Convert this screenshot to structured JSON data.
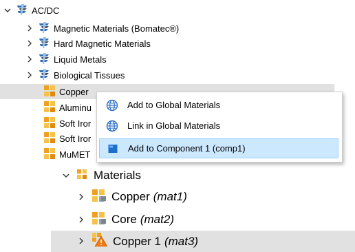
{
  "library_tree": {
    "root": {
      "label": "AC/DC",
      "icon": "acdc-library-icon",
      "expanded": true
    },
    "folders": [
      {
        "label": "Magnetic Materials (Bomatec®)",
        "icon": "acdc-library-icon"
      },
      {
        "label": "Hard Magnetic Materials",
        "icon": "acdc-library-icon"
      },
      {
        "label": "Liquid Metals",
        "icon": "acdc-library-icon"
      },
      {
        "label": "Biological Tissues",
        "icon": "acdc-library-icon"
      }
    ],
    "materials": [
      {
        "label": "Copper",
        "icon": "material-icon",
        "selected": true
      },
      {
        "label": "Aluminu",
        "icon": "material-icon"
      },
      {
        "label": "Soft Iror",
        "icon": "material-icon"
      },
      {
        "label": "Soft Iror",
        "icon": "material-icon"
      },
      {
        "label": "MuMET",
        "icon": "material-icon"
      }
    ]
  },
  "context_menu": {
    "items": [
      {
        "label": "Add to Global Materials",
        "icon": "globe-icon"
      },
      {
        "label": "Link in Global Materials",
        "icon": "globe-icon"
      },
      {
        "label": "Add to Component 1 (comp1)",
        "icon": "component-icon",
        "highlighted": true
      }
    ]
  },
  "model_tree": {
    "node": {
      "label": "Materials",
      "icon": "materials-node-icon",
      "expanded": true
    },
    "children": [
      {
        "name": "Copper",
        "tag": "(mat1)",
        "icon": "material-icon"
      },
      {
        "name": "Core",
        "tag": "(mat2)",
        "icon": "material-icon"
      },
      {
        "name": "Copper 1",
        "tag": "(mat3)",
        "icon": "material-warning-icon",
        "selected": true
      }
    ]
  },
  "colors": {
    "selection": "#e1e1e1",
    "menu_highlight": "#cce8ff",
    "menu_highlight_border": "#99d1ff",
    "material_orange": "#f5a623",
    "library_blue": "#3a6ea5"
  }
}
